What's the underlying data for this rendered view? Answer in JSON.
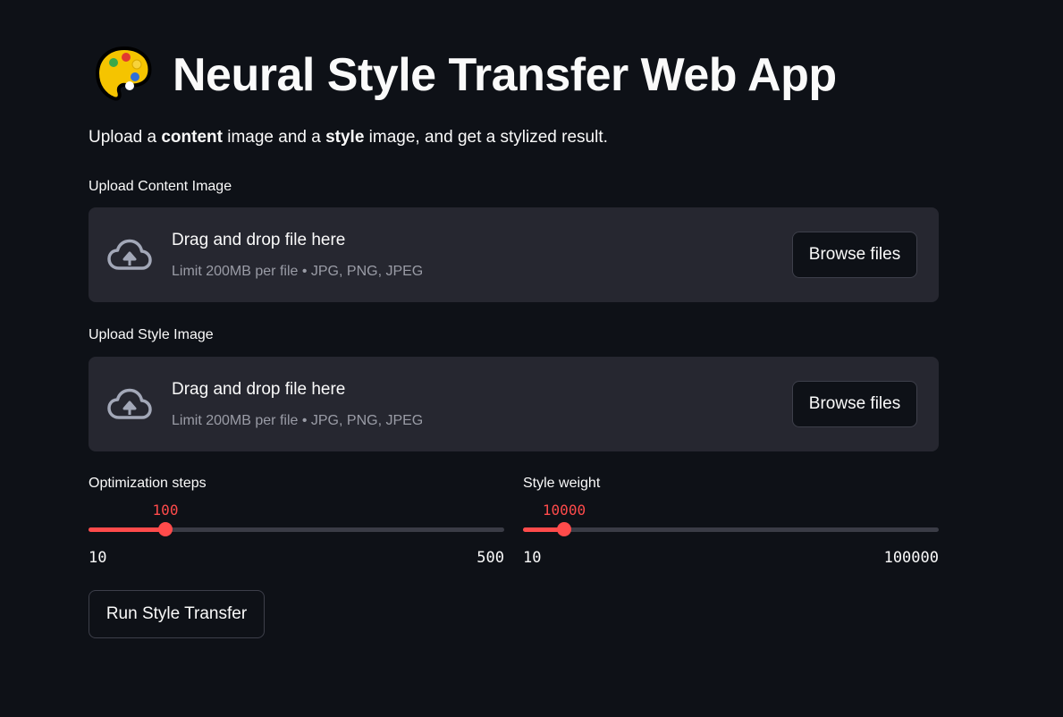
{
  "header": {
    "icon": "palette-icon",
    "title": "Neural Style Transfer Web App"
  },
  "subtitle": {
    "part1": "Upload a ",
    "bold1": "content",
    "part2": " image and a ",
    "bold2": "style",
    "part3": " image, and get a stylized result."
  },
  "content_uploader": {
    "label": "Upload Content Image",
    "drop_text": "Drag and drop file here",
    "limit_text": "Limit 200MB per file • JPG, PNG, JPEG",
    "button_label": "Browse files",
    "icon": "cloud-upload-icon"
  },
  "style_uploader": {
    "label": "Upload Style Image",
    "drop_text": "Drag and drop file here",
    "limit_text": "Limit 200MB per file • JPG, PNG, JPEG",
    "button_label": "Browse files",
    "icon": "cloud-upload-icon"
  },
  "sliders": {
    "steps": {
      "label": "Optimization steps",
      "value": "100",
      "min": "10",
      "max": "500",
      "fraction": 0.184
    },
    "style_weight": {
      "label": "Style weight",
      "value": "10000",
      "min": "10",
      "max": "100000",
      "fraction": 0.0999
    }
  },
  "run_button": {
    "label": "Run Style Transfer"
  },
  "colors": {
    "background": "#0e1117",
    "panel": "#262730",
    "accent": "#ff4b4b",
    "muted_text": "#9a9ca6"
  }
}
